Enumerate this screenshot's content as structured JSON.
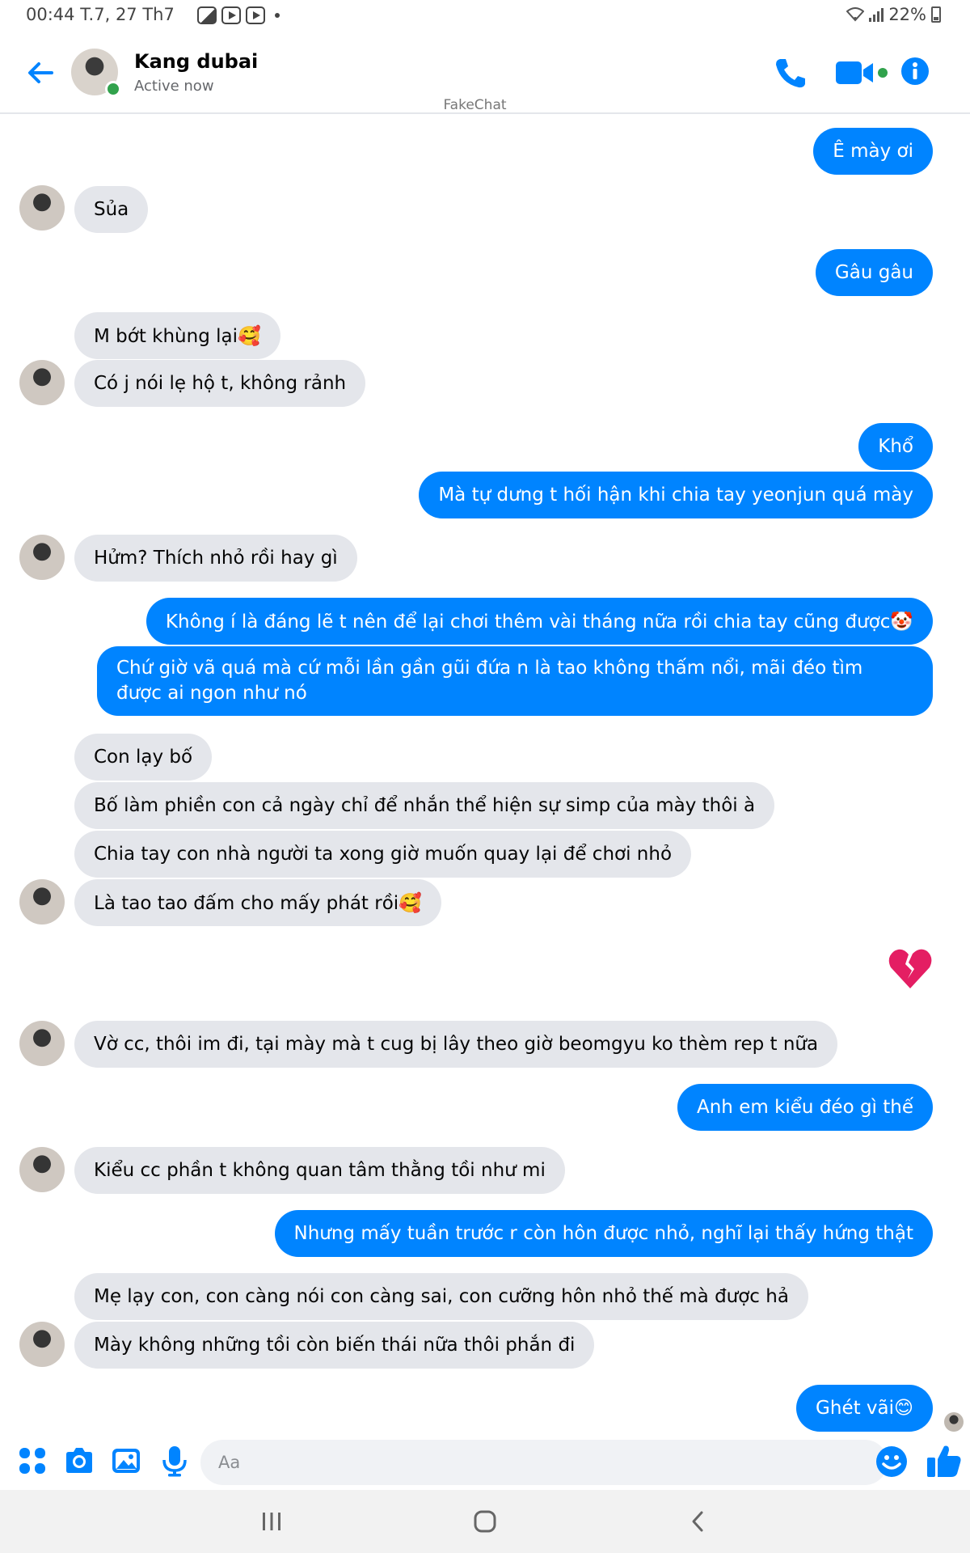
{
  "status_bar": {
    "time": "00:44",
    "date": "T.7, 27 Th7",
    "battery": "22%"
  },
  "header": {
    "contact_name": "Kang dubai",
    "contact_status": "Active now",
    "watermark": "FakeChat",
    "accent_color": "#0084ff",
    "online_color": "#31a24c"
  },
  "messages": [
    {
      "dir": "out",
      "text": "Ê mày ơi"
    },
    {
      "dir": "in",
      "text": "Sủa"
    },
    {
      "dir": "out",
      "text": "Gâu gâu"
    },
    {
      "dir": "in",
      "text": "M bớt khùng lại🥰"
    },
    {
      "dir": "in",
      "text": "Có j nói lẹ hộ t, không rảnh"
    },
    {
      "dir": "out",
      "text": "Khổ"
    },
    {
      "dir": "out",
      "text": "Mà tự dưng t hối hận khi chia tay yeonjun quá mày"
    },
    {
      "dir": "in",
      "text": "Hửm? Thích nhỏ rồi hay gì"
    },
    {
      "dir": "out",
      "text": "Không í là đáng lẽ t nên để lại chơi thêm vài tháng nữa rồi chia tay cũng được🤡"
    },
    {
      "dir": "out",
      "text": "Chứ giờ vã quá mà cứ mỗi lần gần gũi đứa n là tao không thấm nổi, mãi đéo tìm được ai ngon như nó"
    },
    {
      "dir": "in",
      "text": "Con lạy bố"
    },
    {
      "dir": "in",
      "text": "Bố làm phiền con cả ngày chỉ để nhắn thể hiện sự simp của mày thôi à"
    },
    {
      "dir": "in",
      "text": "Chia tay con nhà người ta xong giờ muốn quay lại để chơi nhỏ"
    },
    {
      "dir": "in",
      "text": "Là tao tao đấm cho mấy phát rồi🥰"
    },
    {
      "dir": "out",
      "text": "💔",
      "type": "emoji",
      "icon": "broken-heart-icon"
    },
    {
      "dir": "in",
      "text": "Vờ cc, thôi im đi, tại mày mà t cug bị lây theo  giờ beomgyu ko thèm rep t nữa"
    },
    {
      "dir": "out",
      "text": "Anh em kiểu đéo gì thế"
    },
    {
      "dir": "in",
      "text": "Kiểu cc phần t không quan tâm thằng tồi như mi"
    },
    {
      "dir": "out",
      "text": "Nhưng mấy tuần trước r còn hôn được nhỏ, nghĩ lại thấy hứng thật"
    },
    {
      "dir": "in",
      "text": "Mẹ lạy con, con càng nói con càng sai, con cưỡng hôn nhỏ thế mà được hả"
    },
    {
      "dir": "in",
      "text": "Mày không những tồi còn biến thái nữa thôi phắn đi"
    },
    {
      "dir": "out",
      "text": "Ghét vãi😊"
    }
  ],
  "composer": {
    "placeholder": "Aa",
    "icons": [
      "apps-icon",
      "camera-icon",
      "gallery-icon",
      "microphone-icon",
      "emoji-icon",
      "thumbs-up-icon"
    ]
  }
}
